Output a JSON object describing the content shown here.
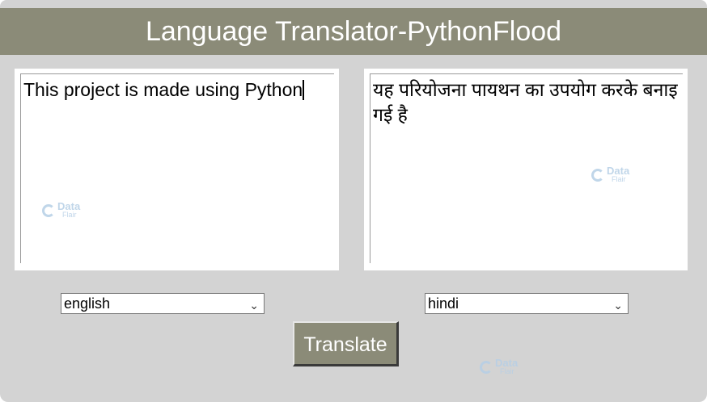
{
  "title": "Language Translator-PythonFlood",
  "source": {
    "text": "This project is made using Python",
    "language": "english"
  },
  "target": {
    "text": "यह परियोजना पायथन का उपयोग करके बनाइ गई है",
    "language": "hindi"
  },
  "translate_button_label": "Translate",
  "watermark": {
    "top": "Data",
    "bottom": "Flair"
  },
  "colors": {
    "accent": "#8b8b78",
    "background": "#d3d3d3",
    "text_on_accent": "#ffffff"
  },
  "icons": {
    "select_arrow": "chevron-down-icon"
  }
}
